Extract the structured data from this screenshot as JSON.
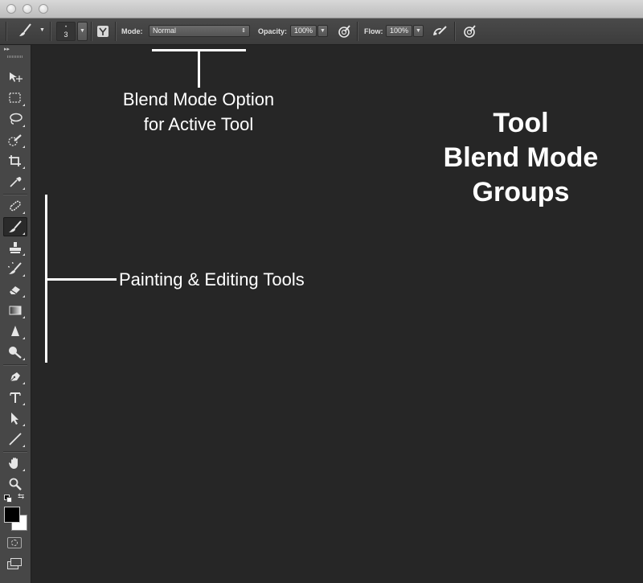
{
  "window": {
    "controls": [
      "close-dot",
      "minimize-dot",
      "zoom-dot"
    ]
  },
  "options_bar": {
    "brush_size": "3",
    "mode_label": "Mode:",
    "mode_value": "Normal",
    "opacity_label": "Opacity:",
    "opacity_value": "100%",
    "flow_label": "Flow:",
    "flow_value": "100%",
    "icons": [
      "brush-preset-icon",
      "brush-panel-icon",
      "pressure-opacity-icon",
      "airbrush-icon",
      "pressure-size-icon"
    ]
  },
  "toolbox": {
    "tools": [
      "move-tool",
      "marquee-tool",
      "lasso-tool",
      "quick-selection-tool",
      "crop-tool",
      "eyedropper-tool",
      "healing-brush-tool",
      "brush-tool",
      "clone-stamp-tool",
      "history-brush-tool",
      "eraser-tool",
      "gradient-tool",
      "blur-tool",
      "dodge-tool",
      "pen-tool",
      "type-tool",
      "path-selection-tool",
      "line-tool",
      "hand-tool",
      "zoom-tool"
    ],
    "active_tool": "brush-tool",
    "foreground_color": "#000000",
    "background_color": "#ffffff"
  },
  "annotations": {
    "blend_option_line1": "Blend Mode Option",
    "blend_option_line2": "for Active Tool",
    "group_title_line1": "Tool",
    "group_title_line2": "Blend Mode",
    "group_title_line3": "Groups",
    "painting_label": "Painting & Editing Tools"
  }
}
